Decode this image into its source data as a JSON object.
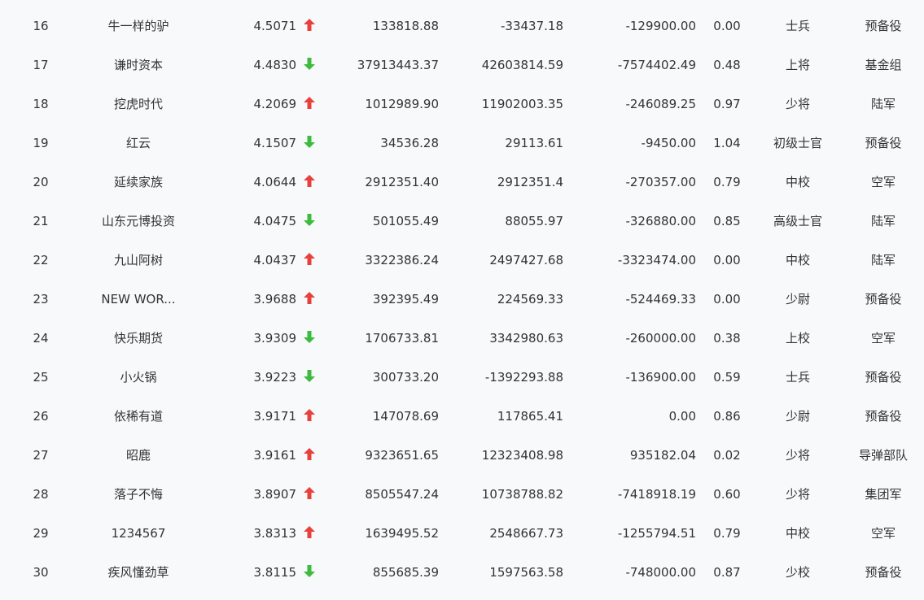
{
  "colors": {
    "up": "#e8413b",
    "down": "#3cbb3c",
    "text": "#333333",
    "background": "#f8f9fb"
  },
  "rows": [
    {
      "rank": "16",
      "name": "牛一样的驴",
      "score": "4.5071",
      "trend": "up-arrow-icon",
      "v1": "133818.88",
      "v2": "-33437.18",
      "v3": "-129900.00",
      "ratio": "0.00",
      "rank_title": "士兵",
      "branch": "预备役"
    },
    {
      "rank": "17",
      "name": "谦时资本",
      "score": "4.4830",
      "trend": "down-arrow-icon",
      "v1": "37913443.37",
      "v2": "42603814.59",
      "v3": "-7574402.49",
      "ratio": "0.48",
      "rank_title": "上将",
      "branch": "基金组"
    },
    {
      "rank": "18",
      "name": "挖虎时代",
      "score": "4.2069",
      "trend": "up-arrow-icon",
      "v1": "1012989.90",
      "v2": "11902003.35",
      "v3": "-246089.25",
      "ratio": "0.97",
      "rank_title": "少将",
      "branch": "陆军"
    },
    {
      "rank": "19",
      "name": "红云",
      "score": "4.1507",
      "trend": "down-arrow-icon",
      "v1": "34536.28",
      "v2": "29113.61",
      "v3": "-9450.00",
      "ratio": "1.04",
      "rank_title": "初级士官",
      "branch": "预备役"
    },
    {
      "rank": "20",
      "name": "延续家族",
      "score": "4.0644",
      "trend": "up-arrow-icon",
      "v1": "2912351.40",
      "v2": "2912351.4",
      "v3": "-270357.00",
      "ratio": "0.79",
      "rank_title": "中校",
      "branch": "空军"
    },
    {
      "rank": "21",
      "name": "山东元博投资",
      "score": "4.0475",
      "trend": "down-arrow-icon",
      "v1": "501055.49",
      "v2": "88055.97",
      "v3": "-326880.00",
      "ratio": "0.85",
      "rank_title": "高级士官",
      "branch": "陆军"
    },
    {
      "rank": "22",
      "name": "九山阿树",
      "score": "4.0437",
      "trend": "up-arrow-icon",
      "v1": "3322386.24",
      "v2": "2497427.68",
      "v3": "-3323474.00",
      "ratio": "0.00",
      "rank_title": "中校",
      "branch": "陆军"
    },
    {
      "rank": "23",
      "name": "NEW WOR...",
      "score": "3.9688",
      "trend": "up-arrow-icon",
      "v1": "392395.49",
      "v2": "224569.33",
      "v3": "-524469.33",
      "ratio": "0.00",
      "rank_title": "少尉",
      "branch": "预备役"
    },
    {
      "rank": "24",
      "name": "快乐期货",
      "score": "3.9309",
      "trend": "down-arrow-icon",
      "v1": "1706733.81",
      "v2": "3342980.63",
      "v3": "-260000.00",
      "ratio": "0.38",
      "rank_title": "上校",
      "branch": "空军"
    },
    {
      "rank": "25",
      "name": "小火锅",
      "score": "3.9223",
      "trend": "down-arrow-icon",
      "v1": "300733.20",
      "v2": "-1392293.88",
      "v3": "-136900.00",
      "ratio": "0.59",
      "rank_title": "士兵",
      "branch": "预备役"
    },
    {
      "rank": "26",
      "name": "依稀有道",
      "score": "3.9171",
      "trend": "up-arrow-icon",
      "v1": "147078.69",
      "v2": "117865.41",
      "v3": "0.00",
      "ratio": "0.86",
      "rank_title": "少尉",
      "branch": "预备役"
    },
    {
      "rank": "27",
      "name": "昭鹿",
      "score": "3.9161",
      "trend": "up-arrow-icon",
      "v1": "9323651.65",
      "v2": "12323408.98",
      "v3": "935182.04",
      "ratio": "0.02",
      "rank_title": "少将",
      "branch": "导弹部队"
    },
    {
      "rank": "28",
      "name": "落子不悔",
      "score": "3.8907",
      "trend": "up-arrow-icon",
      "v1": "8505547.24",
      "v2": "10738788.82",
      "v3": "-7418918.19",
      "ratio": "0.60",
      "rank_title": "少将",
      "branch": "集团军"
    },
    {
      "rank": "29",
      "name": "1234567",
      "score": "3.8313",
      "trend": "up-arrow-icon",
      "v1": "1639495.52",
      "v2": "2548667.73",
      "v3": "-1255794.51",
      "ratio": "0.79",
      "rank_title": "中校",
      "branch": "空军"
    },
    {
      "rank": "30",
      "name": "疾风懂劲草",
      "score": "3.8115",
      "trend": "down-arrow-icon",
      "v1": "855685.39",
      "v2": "1597563.58",
      "v3": "-748000.00",
      "ratio": "0.87",
      "rank_title": "少校",
      "branch": "预备役"
    }
  ]
}
